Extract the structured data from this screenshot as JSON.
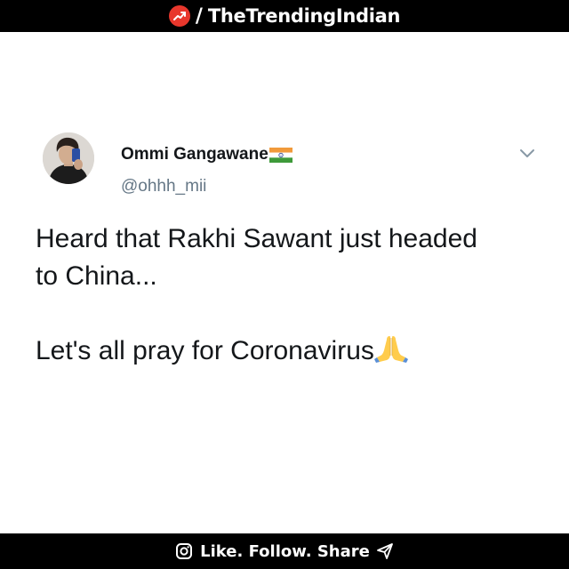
{
  "header": {
    "slash": "/",
    "brand": "TheTrendingIndian",
    "badge_color": "#e8372c",
    "logo_icon": "trending-up-icon"
  },
  "tweet": {
    "display_name": "Ommi Gangawane",
    "handle": "@ohhh_mii",
    "flag_icon": "india-flag-icon",
    "menu_icon": "chevron-down-icon",
    "lines": [
      "Heard that Rakhi Sawant just headed",
      "to China...",
      "Let's all pray for Coronavirus"
    ],
    "emoji": "folded-hands-icon",
    "text_color": "#14171a",
    "handle_color": "#657786"
  },
  "footer": {
    "cta": "Like. Follow. Share",
    "left_icon": "instagram-icon",
    "right_icon": "send-icon"
  }
}
